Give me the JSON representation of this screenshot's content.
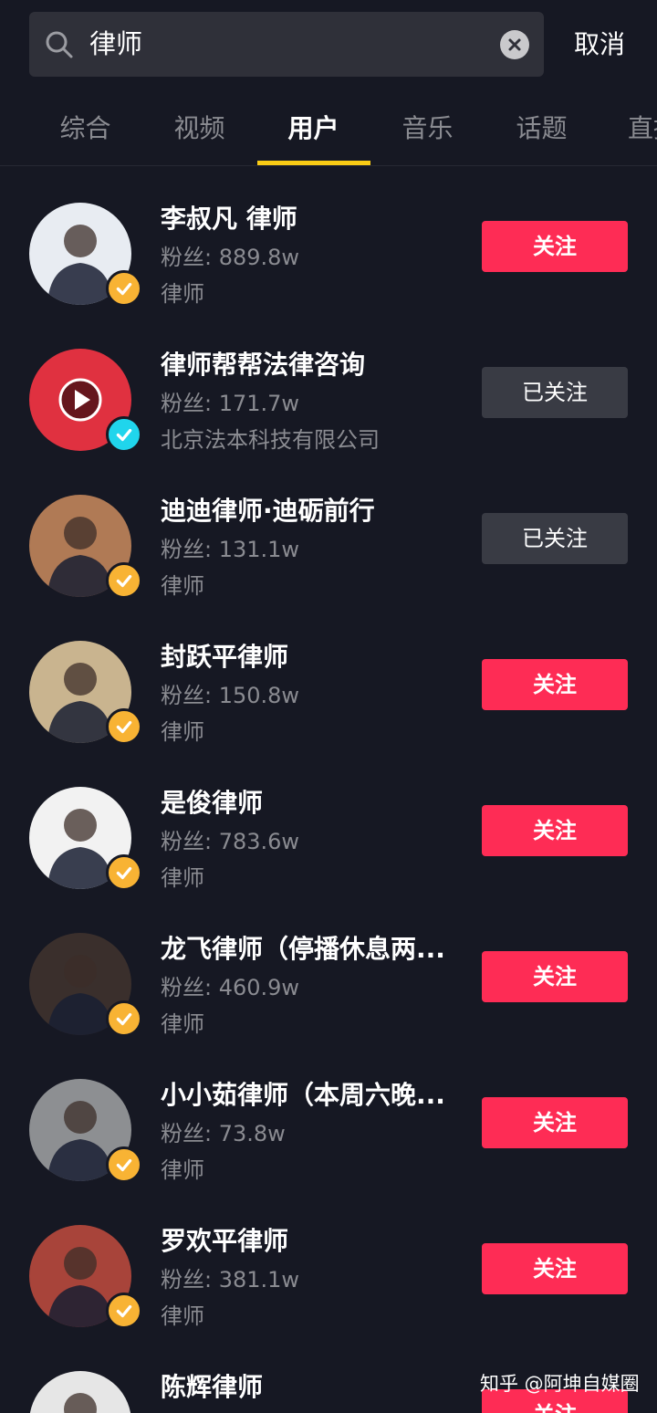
{
  "search": {
    "query": "律师",
    "cancel_label": "取消"
  },
  "tabs": [
    {
      "label": "综合",
      "active": false
    },
    {
      "label": "视频",
      "active": false
    },
    {
      "label": "用户",
      "active": true
    },
    {
      "label": "音乐",
      "active": false
    },
    {
      "label": "话题",
      "active": false
    },
    {
      "label": "直播",
      "active": false
    }
  ],
  "fans_prefix": "粉丝: ",
  "users": [
    {
      "name": "李叔凡 律师",
      "fans": "889.8w",
      "desc": "律师",
      "button": "关注",
      "followed": false,
      "badge": "gold",
      "avatar_color": "#e8ecf2"
    },
    {
      "name": "律师帮帮法律咨询",
      "fans": "171.7w",
      "desc": "北京法本科技有限公司",
      "button": "已关注",
      "followed": true,
      "badge": "blue",
      "avatar_color": "#e03140"
    },
    {
      "name": "迪迪律师·迪砺前行",
      "fans": "131.1w",
      "desc": "律师",
      "button": "已关注",
      "followed": true,
      "badge": "gold",
      "avatar_color": "#b07a55"
    },
    {
      "name": "封跃平律师",
      "fans": "150.8w",
      "desc": "律师",
      "button": "关注",
      "followed": false,
      "badge": "gold",
      "avatar_color": "#c9b48f"
    },
    {
      "name": "是俊律师",
      "fans": "783.6w",
      "desc": "律师",
      "button": "关注",
      "followed": false,
      "badge": "gold",
      "avatar_color": "#f2f2f2"
    },
    {
      "name": "龙飞律师（停播休息两...",
      "fans": "460.9w",
      "desc": "律师",
      "button": "关注",
      "followed": false,
      "badge": "gold",
      "avatar_color": "#3a2f2c"
    },
    {
      "name": "小小茹律师（本周六晚...",
      "fans": "73.8w",
      "desc": "律师",
      "button": "关注",
      "followed": false,
      "badge": "gold",
      "avatar_color": "#8d8f92"
    },
    {
      "name": "罗欢平律师",
      "fans": "381.1w",
      "desc": "律师",
      "button": "关注",
      "followed": false,
      "badge": "gold",
      "avatar_color": "#a8443a"
    },
    {
      "name": "陈辉律师",
      "fans": "",
      "desc": "",
      "button": "关注",
      "followed": false,
      "badge": "gold",
      "avatar_color": "#e6e6e6"
    }
  ],
  "watermark": "知乎 @阿坤自媒圈",
  "colors": {
    "background": "#161823",
    "follow": "#fe2c55",
    "followed": "#393b44",
    "tab_indicator": "#facc15",
    "gold_badge": "#f8b334",
    "blue_badge": "#20d5ec"
  }
}
